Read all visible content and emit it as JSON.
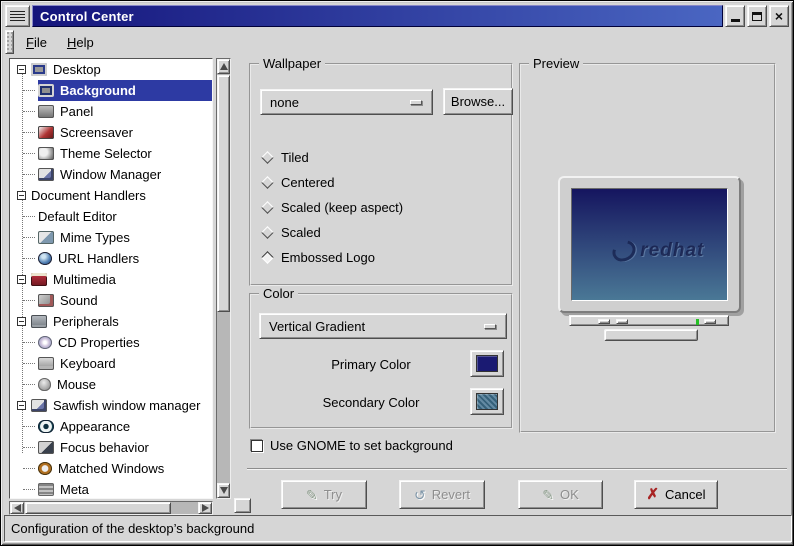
{
  "window": {
    "title": "Control Center"
  },
  "titlebar": {
    "minimize": "minimize",
    "maximize": "maximize",
    "close": "close"
  },
  "menu": {
    "items": [
      {
        "label": "File"
      },
      {
        "label": "Help"
      }
    ]
  },
  "tree": {
    "items": [
      {
        "label": "Desktop",
        "level": 0,
        "expanded": true,
        "icon": "desktop-icon",
        "selected": false
      },
      {
        "label": "Background",
        "level": 1,
        "icon": "background-icon",
        "selected": true
      },
      {
        "label": "Panel",
        "level": 1,
        "icon": "panel-icon",
        "selected": false
      },
      {
        "label": "Screensaver",
        "level": 1,
        "icon": "screensaver-icon",
        "selected": false
      },
      {
        "label": "Theme Selector",
        "level": 1,
        "icon": "theme-selector-icon",
        "selected": false
      },
      {
        "label": "Window Manager",
        "level": 1,
        "icon": "window-manager-icon",
        "selected": false
      },
      {
        "label": "Document Handlers",
        "level": 0,
        "expanded": true,
        "icon": null,
        "selected": false
      },
      {
        "label": "Default Editor",
        "level": 1,
        "icon": null,
        "selected": false
      },
      {
        "label": "Mime Types",
        "level": 1,
        "icon": "mime-types-icon",
        "selected": false
      },
      {
        "label": "URL Handlers",
        "level": 1,
        "icon": "url-handlers-icon",
        "selected": false
      },
      {
        "label": "Multimedia",
        "level": 0,
        "expanded": true,
        "icon": "multimedia-icon",
        "selected": false
      },
      {
        "label": "Sound",
        "level": 1,
        "icon": "sound-icon",
        "selected": false
      },
      {
        "label": "Peripherals",
        "level": 0,
        "expanded": true,
        "icon": "peripherals-icon",
        "selected": false
      },
      {
        "label": "CD Properties",
        "level": 1,
        "icon": "cd-properties-icon",
        "selected": false
      },
      {
        "label": "Keyboard",
        "level": 1,
        "icon": "keyboard-icon",
        "selected": false
      },
      {
        "label": "Mouse",
        "level": 1,
        "icon": "mouse-icon",
        "selected": false
      },
      {
        "label": "Sawfish window manager",
        "level": 0,
        "expanded": true,
        "icon": "sawfish-icon",
        "selected": false
      },
      {
        "label": "Appearance",
        "level": 1,
        "icon": "appearance-icon",
        "selected": false
      },
      {
        "label": "Focus behavior",
        "level": 1,
        "icon": "focus-behavior-icon",
        "selected": false
      },
      {
        "label": "Matched Windows",
        "level": 1,
        "icon": "matched-windows-icon",
        "selected": false
      },
      {
        "label": "Meta",
        "level": 1,
        "icon": "meta-icon",
        "selected": false
      }
    ]
  },
  "wallpaper": {
    "legend": "Wallpaper",
    "file_value": "none",
    "browse_label": "Browse...",
    "modes": [
      {
        "label": "Tiled",
        "selected": false
      },
      {
        "label": "Centered",
        "selected": false
      },
      {
        "label": "Scaled (keep aspect)",
        "selected": false
      },
      {
        "label": "Scaled",
        "selected": false
      },
      {
        "label": "Embossed Logo",
        "selected": true
      }
    ]
  },
  "color": {
    "legend": "Color",
    "gradient_value": "Vertical Gradient",
    "primary_label": "Primary Color",
    "secondary_label": "Secondary Color"
  },
  "preview": {
    "legend": "Preview",
    "logo_text": "redhat"
  },
  "gnome_option": {
    "label": "Use GNOME to set background",
    "checked": false
  },
  "actions": [
    {
      "label": "Try",
      "disabled": true
    },
    {
      "label": "Revert",
      "disabled": true
    },
    {
      "label": "OK",
      "disabled": true
    },
    {
      "label": "Cancel",
      "disabled": false
    }
  ],
  "statusbar": {
    "text": "Configuration of the desktop’s background"
  },
  "theme": {
    "selection": "#2d3aa3",
    "titlebar_start": "#15157c",
    "titlebar_end": "#4a66c2",
    "screen_top": "#15155f",
    "screen_bottom": "#4a7896",
    "primary_color": "#1a1a72",
    "secondary_color": "#41708f"
  }
}
